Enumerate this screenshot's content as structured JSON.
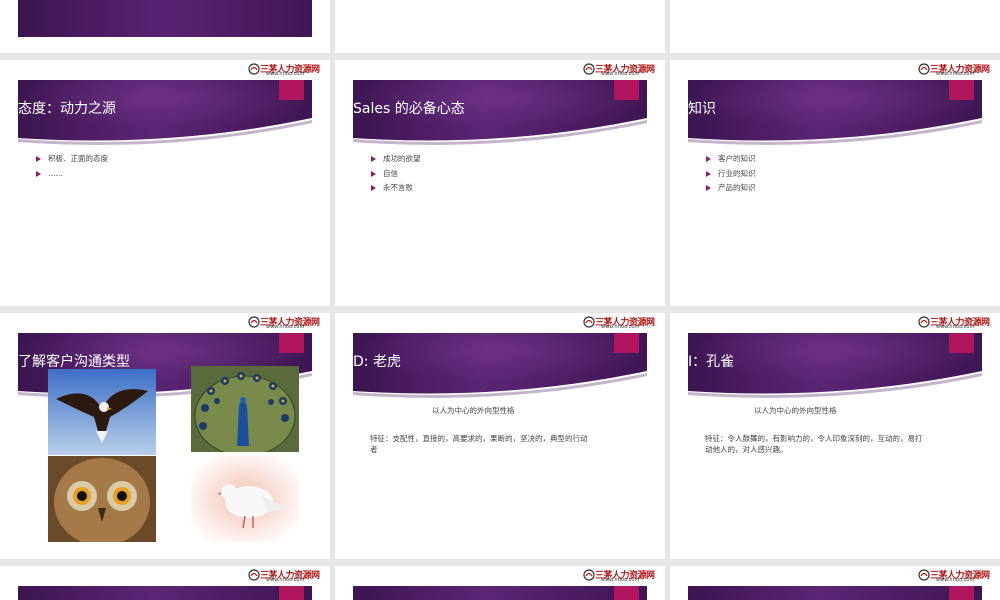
{
  "logo": {
    "name": "三茅人力资源网",
    "url": "www.hrloo.com"
  },
  "slides": [
    {
      "title": "态度：动力之源",
      "bullets": [
        "积极、正面的态度",
        "……"
      ]
    },
    {
      "title": "Sales  的必备心态",
      "bullets": [
        "成功的欲望",
        "自信",
        "永不言败"
      ]
    },
    {
      "title": "知识",
      "bullets": [
        "客户的知识",
        "行业的知识",
        "产品的知识"
      ]
    },
    {
      "title": "了解客户沟通类型",
      "images": [
        "eagle",
        "peacock",
        "owl",
        "dove"
      ]
    },
    {
      "title": "D: 老虎",
      "subtitle": "以人为中心的外向型性格",
      "desc": "特征：支配性，直接的，高要求的，果断的，坚决的，典型的行动者"
    },
    {
      "title": "I：孔雀",
      "subtitle": "以人为中心的外向型性格",
      "desc": "特征：令人鼓舞的，有影响力的，令人印象深刻的，互动的，易打动他人的，对人感兴趣。"
    }
  ],
  "colors": {
    "banner_dark": "#3b1550",
    "banner_mid": "#5a2070",
    "accent_square": "#b0155e",
    "bullet_arrow": "#8b1e68",
    "page_bg": "#e6e6e6"
  }
}
